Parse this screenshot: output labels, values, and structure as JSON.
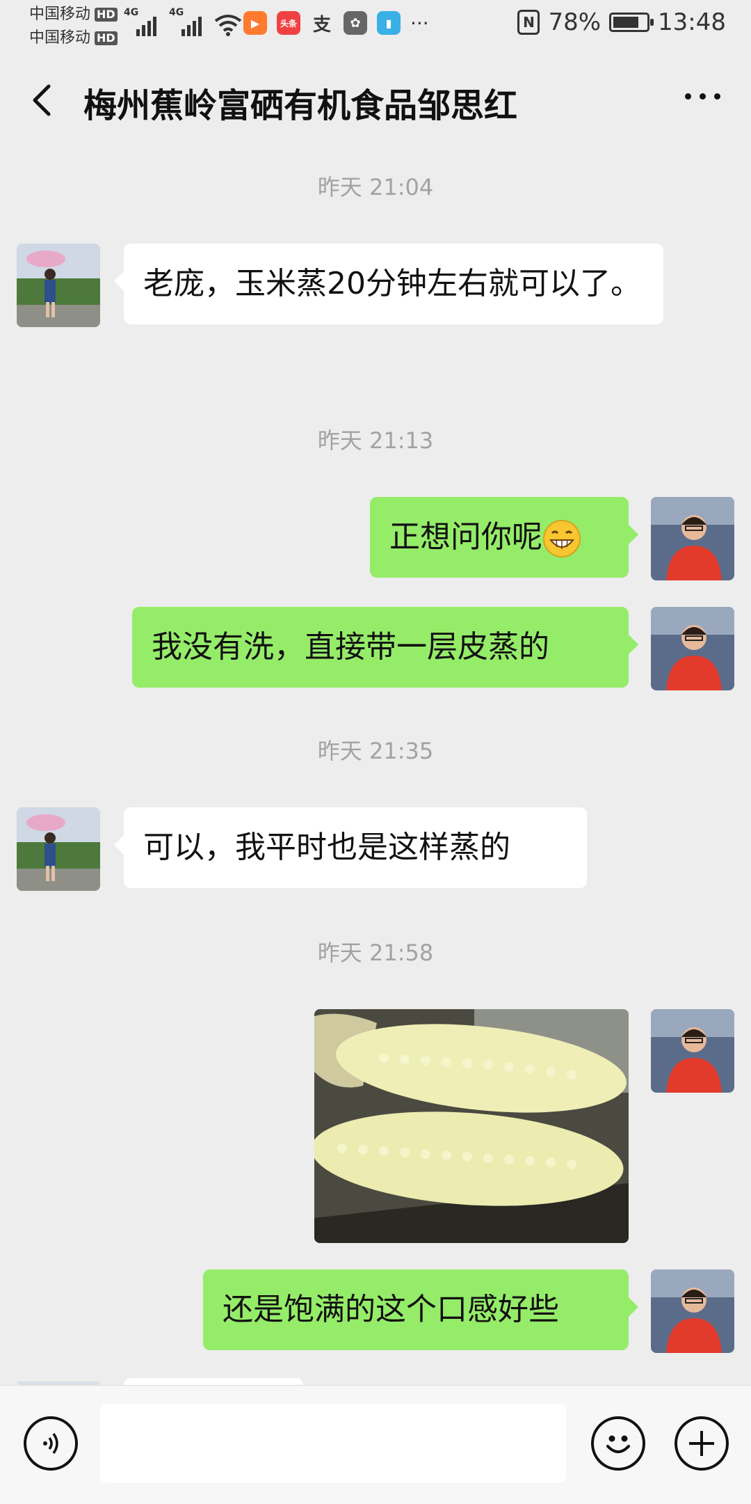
{
  "status": {
    "carrier1": "中国移动",
    "carrier2": "中国移动",
    "hd": "HD",
    "net1": "4G",
    "net2": "4G",
    "nfc": "N",
    "battery": "78%",
    "battery_level": 0.78,
    "time": "13:48",
    "more": "···",
    "app_icons": [
      "video-icon",
      "toutiao-icon",
      "alipay-icon",
      "huawei-icon",
      "reader-icon"
    ]
  },
  "header": {
    "title": "梅州蕉岭富硒有机食品邹思红"
  },
  "chat": {
    "time1": "昨天 21:04",
    "msg1": "老庞，玉米蒸20分钟左右就可以了。",
    "time2": "昨天 21:13",
    "msg2": "正想问你呢",
    "msg3": "我没有洗，直接带一层皮蒸的",
    "time3": "昨天 21:35",
    "msg4": "可以，我平时也是这样蒸的",
    "time4": "昨天 21:58",
    "msg6": "还是饱满的这个口感好些"
  },
  "colors": {
    "background": "#ededed",
    "outgoing_bubble": "#95ec69",
    "incoming_bubble": "#ffffff",
    "timestamp": "#a2a2a2"
  }
}
